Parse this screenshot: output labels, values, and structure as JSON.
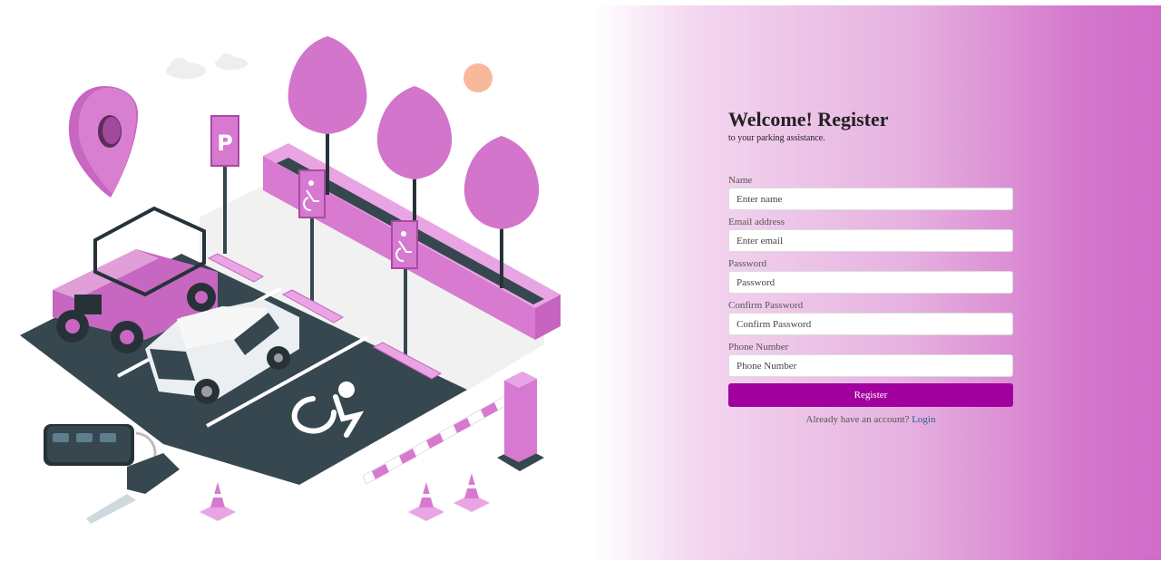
{
  "form": {
    "title": "Welcome! Register",
    "subtitle": "to your parking assistance.",
    "fields": [
      {
        "label": "Name",
        "placeholder": "Enter name"
      },
      {
        "label": "Email address",
        "placeholder": "Enter email"
      },
      {
        "label": "Password",
        "placeholder": "Password"
      },
      {
        "label": "Confirm Password",
        "placeholder": "Confirm Password"
      },
      {
        "label": "Phone Number",
        "placeholder": "Phone Number"
      }
    ],
    "register_label": "Register",
    "login_prompt": "Already have an account?",
    "login_link": "Login"
  },
  "colors": {
    "accent": "#a2009e",
    "illustration_pink": "#d779d0",
    "asphalt": "#37474f"
  },
  "illustration": {
    "parking_sign": "P"
  }
}
